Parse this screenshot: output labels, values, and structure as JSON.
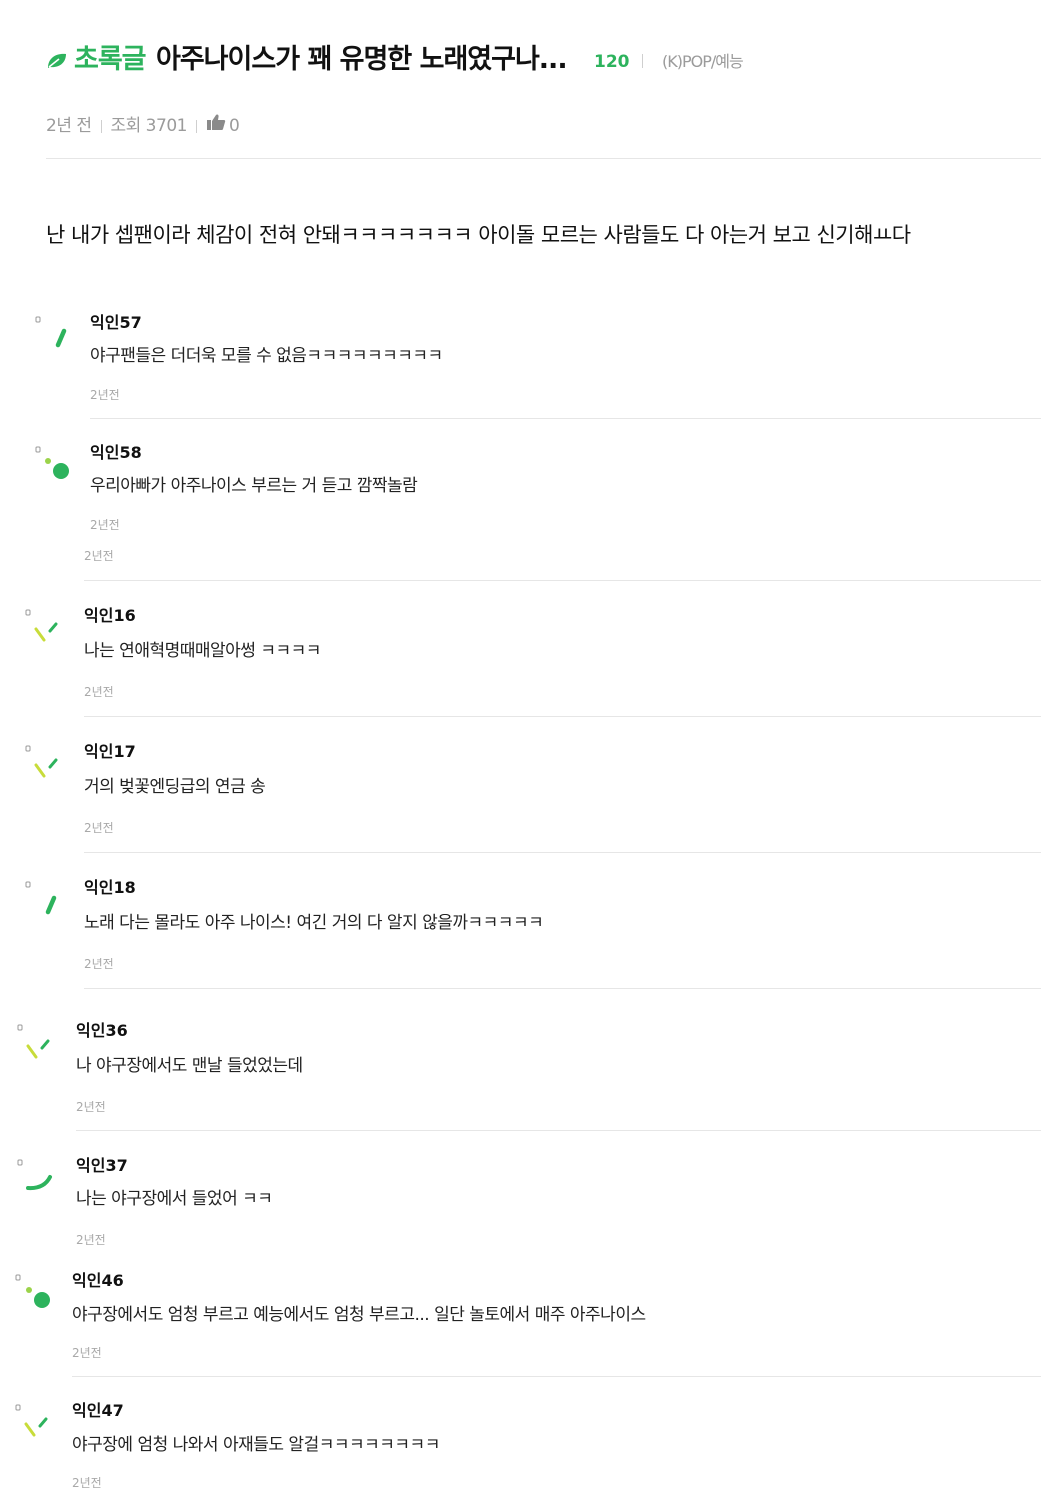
{
  "post": {
    "board_label": "초록글",
    "title": "아주나이스가 꽤 유명한 노래였구나...",
    "comment_count": "120",
    "category": "(K)POP/예능",
    "time": "2년 전",
    "views": "조회 3701",
    "likes": "0",
    "body": "난 내가 셉팬이라 체감이 전혀 안돼ㅋㅋㅋㅋㅋㅋㅋ 아이돌 모르는 사람들도 다 아는거 보고 신기해ㅛ다"
  },
  "colors": {
    "accent": "#2db35d",
    "leaf": "#2db35d",
    "muted": "#9b9b9b"
  },
  "comments": [
    {
      "author": "익인57",
      "text": "야구팬들은 더더욱 모를 수 없음ㅋㅋㅋㅋㅋㅋㅋㅋㅋ",
      "time": "2년전",
      "icon": "green-stroke-icon"
    },
    {
      "author": "익인58",
      "text": "우리아빠가 아주나이스 부르는 거 듣고 깜짝놀람",
      "time": "2년전",
      "extra_time": "2년전",
      "icon": "green-dot-icon"
    },
    {
      "author": "익인16",
      "text": "나는 연애혁명때매알아썽 ㅋㅋㅋㅋ",
      "time": "2년전",
      "icon": "yellow-green-tick-icon"
    },
    {
      "author": "익인17",
      "text": "거의 벚꽃엔딩급의 연금 송",
      "time": "2년전",
      "icon": "yellow-green-tick-icon"
    },
    {
      "author": "익인18",
      "text": "노래 다는 몰라도 아주 나이스! 여긴 거의 다 알지 않을까ㅋㅋㅋㅋㅋ",
      "time": "2년전",
      "icon": "green-stroke-icon"
    },
    {
      "author": "익인36",
      "text": "나 야구장에서도 맨날 들었었는데",
      "time": "2년전",
      "icon": "yellow-green-tick-icon"
    },
    {
      "author": "익인37",
      "text": "나는 야구장에서 들었어 ㅋㅋ",
      "time": "2년전",
      "icon": "green-curve-icon"
    },
    {
      "author": "익인46",
      "text": "야구장에서도 엄청 부르고 예능에서도 엄청 부르고... 일단 놀토에서 매주 아주나이스",
      "time": "2년전",
      "icon": "green-dot-icon"
    },
    {
      "author": "익인47",
      "text": "야구장에 엄청 나와서 아재들도 알걸ㅋㅋㅋㅋㅋㅋㅋㅋ",
      "time": "2년전",
      "icon": "yellow-green-tick-icon"
    }
  ]
}
